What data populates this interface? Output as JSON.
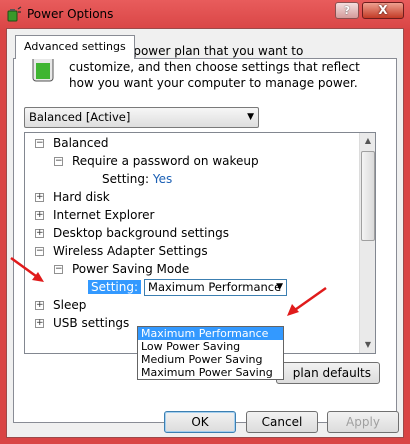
{
  "window": {
    "title": "Power Options",
    "help_label": "?",
    "close_label": "X"
  },
  "tab": {
    "label": "Advanced settings"
  },
  "intro_text": "Select the power plan that you want to customize, and then choose settings that reflect how you want your computer to manage power.",
  "plan_select": {
    "value": "Balanced [Active]"
  },
  "tree": {
    "balanced": {
      "label": "Balanced",
      "expander": "−"
    },
    "require_password": {
      "label": "Require a password on wakeup",
      "expander": "−"
    },
    "require_password_setting": {
      "label": "Setting:",
      "value": "Yes"
    },
    "hard_disk": {
      "label": "Hard disk",
      "expander": "+"
    },
    "internet_explorer": {
      "label": "Internet Explorer",
      "expander": "+"
    },
    "desktop_background": {
      "label": "Desktop background settings",
      "expander": "+"
    },
    "wireless_adapter": {
      "label": "Wireless Adapter Settings",
      "expander": "−"
    },
    "power_saving_mode": {
      "label": "Power Saving Mode",
      "expander": "−"
    },
    "power_saving_setting": {
      "label": "Setting:",
      "value": "Maximum Performance"
    },
    "sleep": {
      "label": "Sleep",
      "expander": "+"
    },
    "usb": {
      "label": "USB settings",
      "expander": "+"
    }
  },
  "dropdown_options": [
    "Maximum Performance",
    "Low Power Saving",
    "Medium Power Saving",
    "Maximum Power Saving"
  ],
  "restore_button": {
    "label": "plan defaults"
  },
  "buttons": {
    "ok": "OK",
    "cancel": "Cancel",
    "apply": "Apply"
  },
  "colors": {
    "titlebar": "#d94545",
    "selection": "#3399ff",
    "link": "#1a5fb4",
    "annotation_arrow": "#e01b1b"
  }
}
